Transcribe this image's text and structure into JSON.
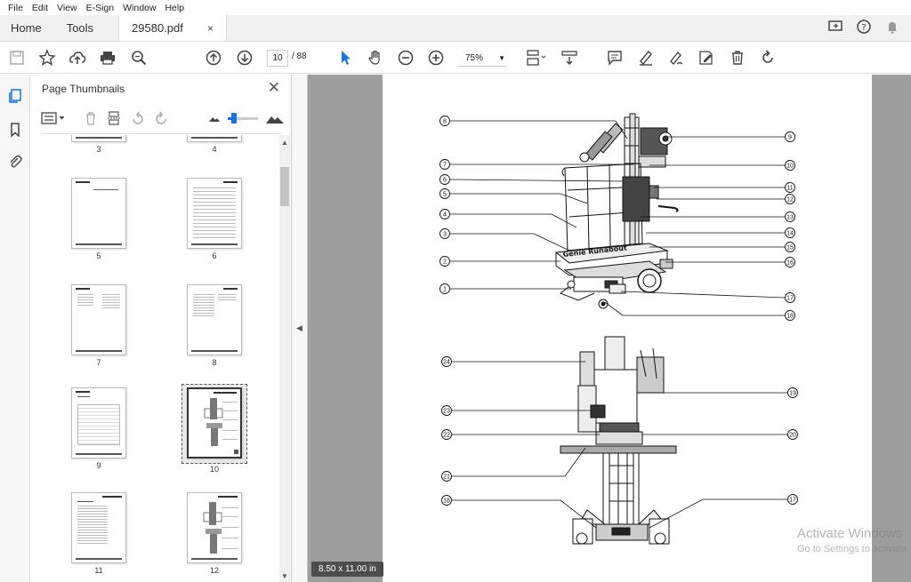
{
  "menu": [
    "File",
    "Edit",
    "View",
    "E-Sign",
    "Window",
    "Help"
  ],
  "tabs": {
    "home": "Home",
    "tools": "Tools",
    "document": "29580.pdf",
    "close": "×"
  },
  "toolbar": {
    "current_page": "10",
    "total_pages": "/ 88",
    "zoom": "75%"
  },
  "panel": {
    "title": "Page Thumbnails",
    "close": "✕",
    "thumbnails": [
      {
        "label": "3"
      },
      {
        "label": "4"
      },
      {
        "label": "5"
      },
      {
        "label": "6"
      },
      {
        "label": "7"
      },
      {
        "label": "8"
      },
      {
        "label": "9"
      },
      {
        "label": "10"
      },
      {
        "label": "11"
      },
      {
        "label": "12"
      }
    ]
  },
  "document": {
    "page_size": "8.50 x 11.00 in",
    "callouts_top": [
      "8",
      "7",
      "6",
      "5",
      "4",
      "3",
      "2",
      "1",
      "9",
      "10",
      "11",
      "12",
      "13",
      "14",
      "15",
      "16",
      "17",
      "18"
    ],
    "callouts_bottom": [
      "24",
      "23",
      "22",
      "21",
      "18",
      "19",
      "20",
      "17"
    ]
  },
  "watermark": {
    "line1": "Activate Windows",
    "line2": "Go to Settings to activate"
  },
  "colors": {
    "accent": "#1473e6",
    "doc_background": "#9e9e9e"
  }
}
